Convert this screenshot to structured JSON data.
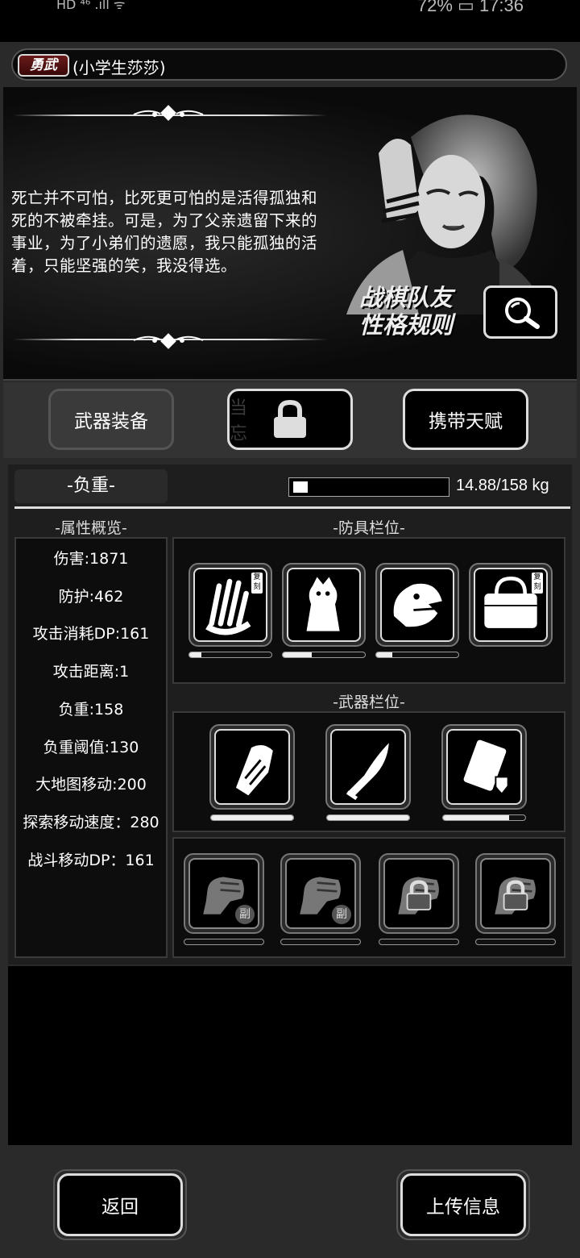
{
  "status_bar": {
    "left": "HD ⁴⁶ .ıll ᯤ",
    "battery": "72%",
    "time": "17:36"
  },
  "header": {
    "badge": "勇武",
    "name": "(小学生莎莎)"
  },
  "story": {
    "quote": "死亡并不可怕，比死更可怕的是活得孤独和死的不被牵挂。可是，为了父亲遗留下来的事业，为了小弟们的遗愿，我只能孤独的活着，只能坚强的笑，我没得选。",
    "rule_line1": "战棋队友",
    "rule_line2": "性格规则"
  },
  "tabs": {
    "weapons": "武器装备",
    "locked_hint": "当 忘",
    "talent": "携带天赋"
  },
  "load": {
    "label": "-负重-",
    "value": "14.88/158 kg",
    "fill_fraction": 0.094
  },
  "attributes": {
    "title": "-属性概览-",
    "items": [
      "伤害:1871",
      "防护:462",
      "攻击消耗DP:161",
      "攻击距离:1",
      "负重:158",
      "负重阈值:130",
      "大地图移动:200",
      "探索移动速度：280",
      "战斗移动DP：161"
    ]
  },
  "armor": {
    "title": "-防具栏位-",
    "slots": [
      {
        "icon": "gloves-icon",
        "tag": "复刻",
        "durability": 0.15
      },
      {
        "icon": "hooded-costume-icon",
        "tag": "",
        "durability": 0.35
      },
      {
        "icon": "dinosaur-head-icon",
        "tag": "",
        "durability": 0.2
      },
      {
        "icon": "handbag-icon",
        "tag": "复刻",
        "durability": null
      }
    ]
  },
  "weapons": {
    "title": "-武器栏位-",
    "slots": [
      {
        "icon": "gauntlet-icon",
        "durability": 1.0
      },
      {
        "icon": "blade-icon",
        "durability": 1.0
      },
      {
        "icon": "shield-pack-icon",
        "durability": 0.8
      }
    ]
  },
  "sub_slots": {
    "badge": "副",
    "slots": [
      {
        "icon": "fist-icon",
        "state": "sub"
      },
      {
        "icon": "fist-icon",
        "state": "sub"
      },
      {
        "icon": "fist-icon",
        "state": "locked"
      },
      {
        "icon": "fist-icon",
        "state": "locked"
      }
    ]
  },
  "footer": {
    "back": "返回",
    "upload": "上传信息"
  }
}
